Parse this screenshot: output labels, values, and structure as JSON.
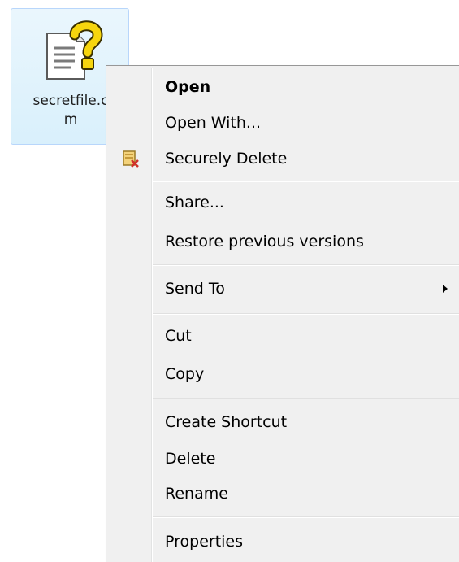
{
  "file": {
    "name": "secretfile.c\nm",
    "icon": "unknown-file-icon"
  },
  "menu": {
    "items": [
      {
        "label": "Open",
        "bold": true
      },
      {
        "label": "Open With..."
      },
      {
        "label": "Securely Delete",
        "icon": "secure-delete-icon"
      },
      {
        "label": "Share..."
      },
      {
        "label": "Restore previous versions"
      },
      {
        "label": "Send To",
        "submenu": true
      },
      {
        "label": "Cut"
      },
      {
        "label": "Copy"
      },
      {
        "label": "Create Shortcut"
      },
      {
        "label": "Delete"
      },
      {
        "label": "Rename"
      },
      {
        "label": "Properties"
      }
    ]
  }
}
